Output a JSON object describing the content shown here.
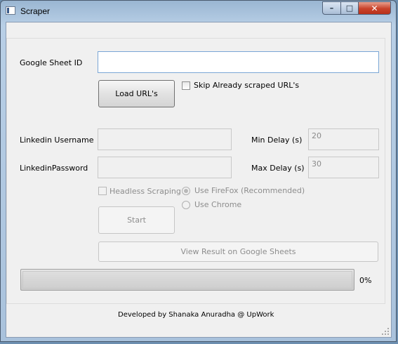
{
  "window": {
    "title": "Scraper",
    "controls": {
      "minimize": "–",
      "maximize": "□",
      "close": "✕"
    }
  },
  "form": {
    "sheet_id_label": "Google Sheet ID",
    "sheet_id_value": "",
    "load_button": "Load URL's",
    "skip_checkbox_label": "Skip Already scraped URL's",
    "username_label": "Linkedin Username",
    "username_value": "",
    "password_label": "LinkedinPassword",
    "password_value": "",
    "min_delay_label": "Min Delay (s)",
    "min_delay_value": "20",
    "max_delay_label": "Max Delay (s)",
    "max_delay_value": "30",
    "headless_label": "Headless Scraping",
    "firefox_label": "Use FireFox (Recommended)",
    "chrome_label": "Use Chrome",
    "start_button": "Start",
    "view_result_button": "View Result on Google Sheets",
    "progress_text": "0%",
    "progress_value": 0
  },
  "footer": {
    "credit": "Developed by Shanaka Anuradha @ UpWork"
  },
  "icons": [
    "app-icon",
    "minimize-icon",
    "maximize-icon",
    "close-icon",
    "resize-grip-icon"
  ]
}
